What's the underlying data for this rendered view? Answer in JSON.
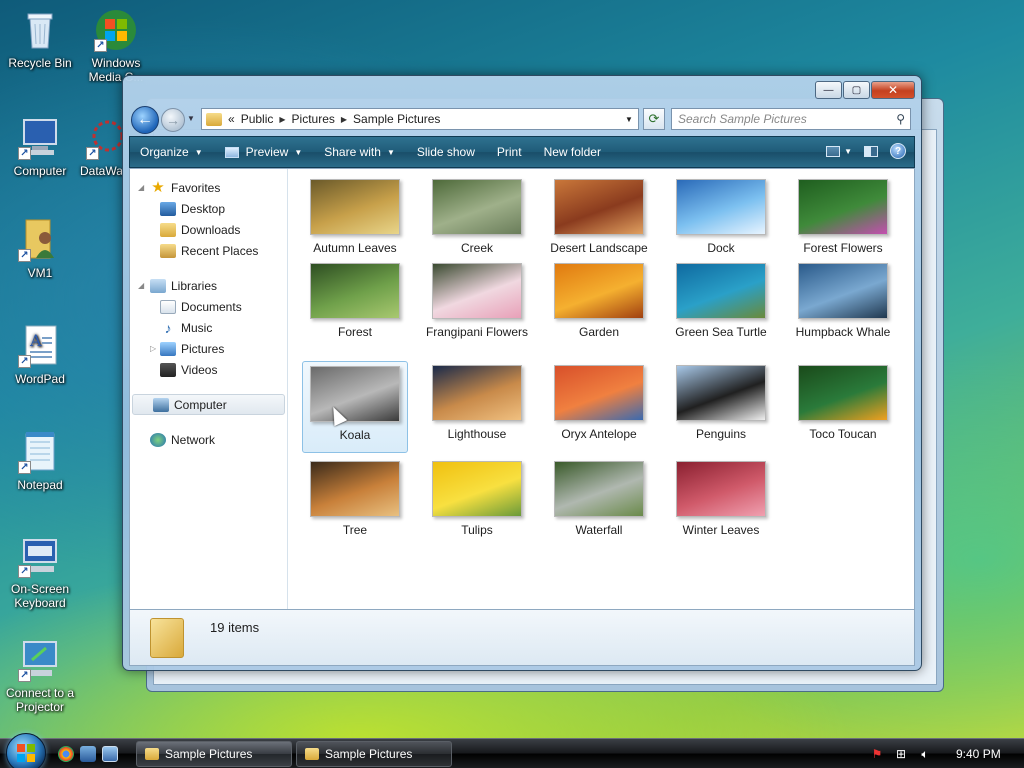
{
  "desktop": {
    "icons": [
      {
        "label": "Recycle Bin"
      },
      {
        "label": "Windows Media C..."
      },
      {
        "label": "Computer"
      },
      {
        "label": "DataWa"
      },
      {
        "label": "VM1"
      },
      {
        "label": "WordPad"
      },
      {
        "label": "Notepad"
      },
      {
        "label": "On-Screen Keyboard"
      },
      {
        "label": "Connect to a Projector"
      }
    ]
  },
  "explorer": {
    "breadcrumb": [
      "Public",
      "Pictures",
      "Sample Pictures"
    ],
    "breadcrumb_prefix": "«",
    "search_placeholder": "Search Sample Pictures",
    "caption_buttons": {
      "minimize": "—",
      "maximize": "▢",
      "close": "✕"
    },
    "commands": [
      {
        "label": "Organize",
        "dropdown": true
      },
      {
        "label": "Preview",
        "dropdown": true
      },
      {
        "label": "Share with",
        "dropdown": true
      },
      {
        "label": "Slide show",
        "dropdown": false
      },
      {
        "label": "Print",
        "dropdown": false
      },
      {
        "label": "New folder",
        "dropdown": false
      }
    ],
    "help_label": "?",
    "nav": {
      "favorites": {
        "label": "Favorites",
        "items": [
          "Desktop",
          "Downloads",
          "Recent Places"
        ]
      },
      "libraries": {
        "label": "Libraries",
        "items": [
          "Documents",
          "Music",
          "Pictures",
          "Videos"
        ]
      },
      "computer": "Computer",
      "network": "Network"
    },
    "files": [
      {
        "name": "Autumn Leaves",
        "colors": [
          "#6b5a2a",
          "#c7a04a",
          "#e8d58a"
        ]
      },
      {
        "name": "Creek",
        "colors": [
          "#4e6a3a",
          "#9fb08a",
          "#6a7d5a"
        ]
      },
      {
        "name": "Desert Landscape",
        "colors": [
          "#c9773a",
          "#8a3b1e",
          "#e0a060"
        ]
      },
      {
        "name": "Dock",
        "colors": [
          "#2a6ab8",
          "#7cc0f0",
          "#e8f4ff"
        ]
      },
      {
        "name": "Forest Flowers",
        "colors": [
          "#1f5e1f",
          "#3f8a3a",
          "#c44fb0"
        ]
      },
      {
        "name": "Forest",
        "colors": [
          "#2e4e22",
          "#6fa04a",
          "#a8c870"
        ]
      },
      {
        "name": "Frangipani Flowers",
        "colors": [
          "#3a4a30",
          "#f0d8e0",
          "#e8a0b8"
        ]
      },
      {
        "name": "Garden",
        "colors": [
          "#e07a10",
          "#f5b030",
          "#a04010"
        ]
      },
      {
        "name": "Green Sea Turtle",
        "colors": [
          "#0f6aa0",
          "#2aa0c8",
          "#6a8a3a"
        ]
      },
      {
        "name": "Humpback Whale",
        "colors": [
          "#2a5a8a",
          "#7aa8d0",
          "#20384f"
        ]
      },
      {
        "name": "Koala",
        "colors": [
          "#6a6a6a",
          "#b8b8b8",
          "#3a3a3a"
        ]
      },
      {
        "name": "Lighthouse",
        "colors": [
          "#1a2a4a",
          "#c88a4a",
          "#f0c080"
        ]
      },
      {
        "name": "Oryx Antelope",
        "colors": [
          "#d8502a",
          "#f08040",
          "#3a6ab0"
        ]
      },
      {
        "name": "Penguins",
        "colors": [
          "#a8c8e8",
          "#202020",
          "#f0f0f0"
        ]
      },
      {
        "name": "Toco Toucan",
        "colors": [
          "#1a4a1a",
          "#2a7a3a",
          "#f0a020"
        ]
      },
      {
        "name": "Tree",
        "colors": [
          "#3a2a1a",
          "#c8803a",
          "#e8c080"
        ]
      },
      {
        "name": "Tulips",
        "colors": [
          "#f0c010",
          "#f8e040",
          "#6a9a3a"
        ]
      },
      {
        "name": "Waterfall",
        "colors": [
          "#3a5a2a",
          "#b0b8b0",
          "#6a8a4a"
        ]
      },
      {
        "name": "Winter Leaves",
        "colors": [
          "#8a2030",
          "#d05a6a",
          "#f0a0b0"
        ]
      }
    ],
    "selected_file": "Koala",
    "status": "19 items"
  },
  "taskbar": {
    "start_label": "Start",
    "buttons": [
      {
        "label": "Sample Pictures",
        "active": true
      },
      {
        "label": "Sample Pictures",
        "active": false
      }
    ],
    "clock": "9:40 PM"
  }
}
